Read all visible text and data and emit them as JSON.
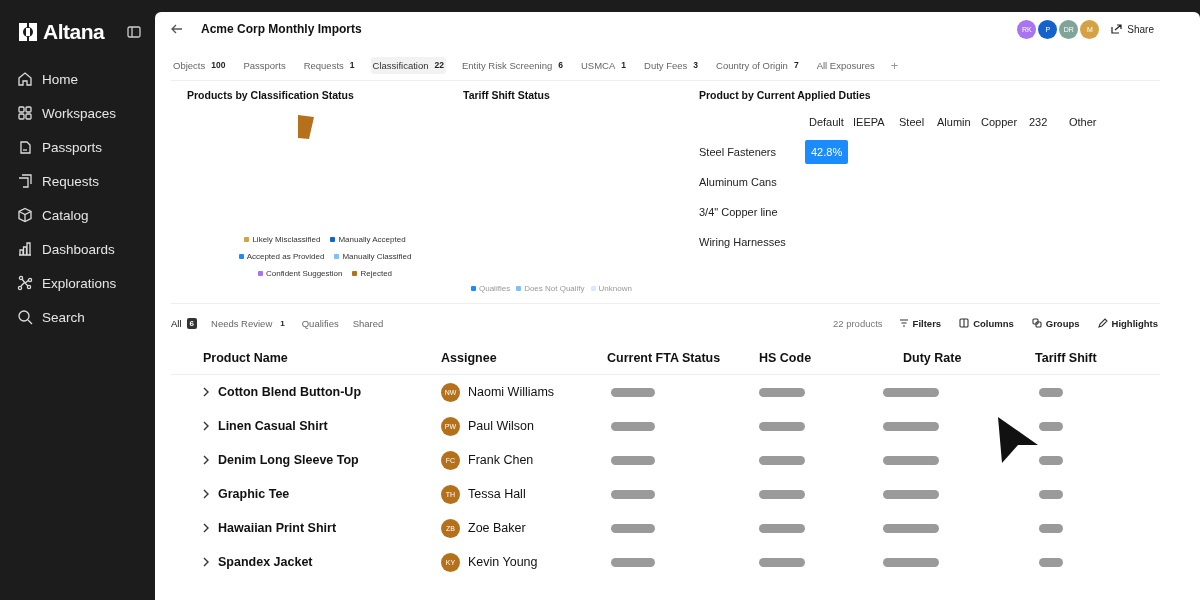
{
  "sidebar": {
    "brand": "Altana",
    "items": [
      {
        "label": "Home"
      },
      {
        "label": "Workspaces"
      },
      {
        "label": "Passports"
      },
      {
        "label": "Requests"
      },
      {
        "label": "Catalog"
      },
      {
        "label": "Dashboards"
      },
      {
        "label": "Explorations"
      },
      {
        "label": "Search"
      }
    ]
  },
  "header": {
    "title": "Acme Corp Monthly Imports",
    "avatars": [
      {
        "initials": "RK",
        "color": "#a874f0"
      },
      {
        "initials": "P",
        "color": "#1463cc"
      },
      {
        "initials": "DR",
        "color": "#7fa59a"
      },
      {
        "initials": "M",
        "color": "#d4a244"
      }
    ],
    "share": "Share"
  },
  "tabs": [
    {
      "label": "Objects",
      "count": "100",
      "selected": false
    },
    {
      "label": "Passports",
      "selected": false
    },
    {
      "label": "Requests",
      "count": "1",
      "selected": false
    },
    {
      "label": "Classification",
      "count": "22",
      "selected": true
    },
    {
      "label": "Entity Risk Screening",
      "count": "6",
      "selected": false
    },
    {
      "label": "USMCA",
      "count": "1",
      "selected": false
    },
    {
      "label": "Duty Fees",
      "count": "3",
      "selected": false
    },
    {
      "label": "Country of Origin",
      "count": "7",
      "selected": false
    },
    {
      "label": "All Exposures",
      "selected": false
    }
  ],
  "add_tab": "+",
  "classification_chart": {
    "title": "Products by Classification Status",
    "legend": [
      [
        {
          "label": "Likely Misclassified",
          "color": "#d4a244"
        },
        {
          "label": "Manually Accepted",
          "color": "#1463cc"
        }
      ],
      [
        {
          "label": "Accepted as Provided",
          "color": "#1a8cff"
        },
        {
          "label": "Manually Classified",
          "color": "#7cc0ff"
        }
      ],
      [
        {
          "label": "Confident Suggestion",
          "color": "#a874f0"
        },
        {
          "label": "Rejected",
          "color": "#b5701c"
        }
      ]
    ]
  },
  "tariff_chart": {
    "title": "Tariff Shift Status",
    "legend": [
      {
        "label": "Qualifies",
        "color": "#1a8cff"
      },
      {
        "label": "Does Not Qualify",
        "color": "#7cc0ff"
      },
      {
        "label": "Unknown",
        "color": "#d6ebff"
      }
    ]
  },
  "duties_heatmap": {
    "title": "Product by Current Applied Duties",
    "columns": [
      "Default",
      "IEEPA",
      "Steel",
      "Alumin",
      "Copper",
      "232",
      "Other"
    ],
    "rows": [
      {
        "label": "Steel Fasteners",
        "default_value": "42.8%"
      },
      {
        "label": "Aluminum Cans"
      },
      {
        "label": "3/4\" Copper line"
      },
      {
        "label": "Wiring Harnesses"
      }
    ]
  },
  "views": [
    {
      "label": "All",
      "count": "6",
      "selected": true
    },
    {
      "label": "Needs Review",
      "count": "1",
      "selected": false
    },
    {
      "label": "Qualifies",
      "selected": false
    },
    {
      "label": "Shared",
      "selected": false
    }
  ],
  "product_count": "22 products",
  "toolbar": [
    {
      "label": "Filters"
    },
    {
      "label": "Columns"
    },
    {
      "label": "Groups"
    },
    {
      "label": "Highlights"
    }
  ],
  "table": {
    "columns": [
      "Product Name",
      "Assignee",
      "Current FTA Status",
      "HS Code",
      "Duty Rate",
      "Tariff Shift"
    ],
    "rows": [
      {
        "product": "Cotton Blend Button-Up",
        "initials": "NW",
        "assignee": "Naomi Williams"
      },
      {
        "product": "Linen Casual Shirt",
        "initials": "PW",
        "assignee": "Paul Wilson"
      },
      {
        "product": "Denim Long Sleeve Top",
        "initials": "FC",
        "assignee": "Frank Chen"
      },
      {
        "product": "Graphic Tee",
        "initials": "TH",
        "assignee": "Tessa Hall"
      },
      {
        "product": "Hawaiian Print Shirt",
        "initials": "ZB",
        "assignee": "Zoe Baker"
      },
      {
        "product": "Spandex Jacket",
        "initials": "KY",
        "assignee": "Kevin Young"
      }
    ]
  }
}
